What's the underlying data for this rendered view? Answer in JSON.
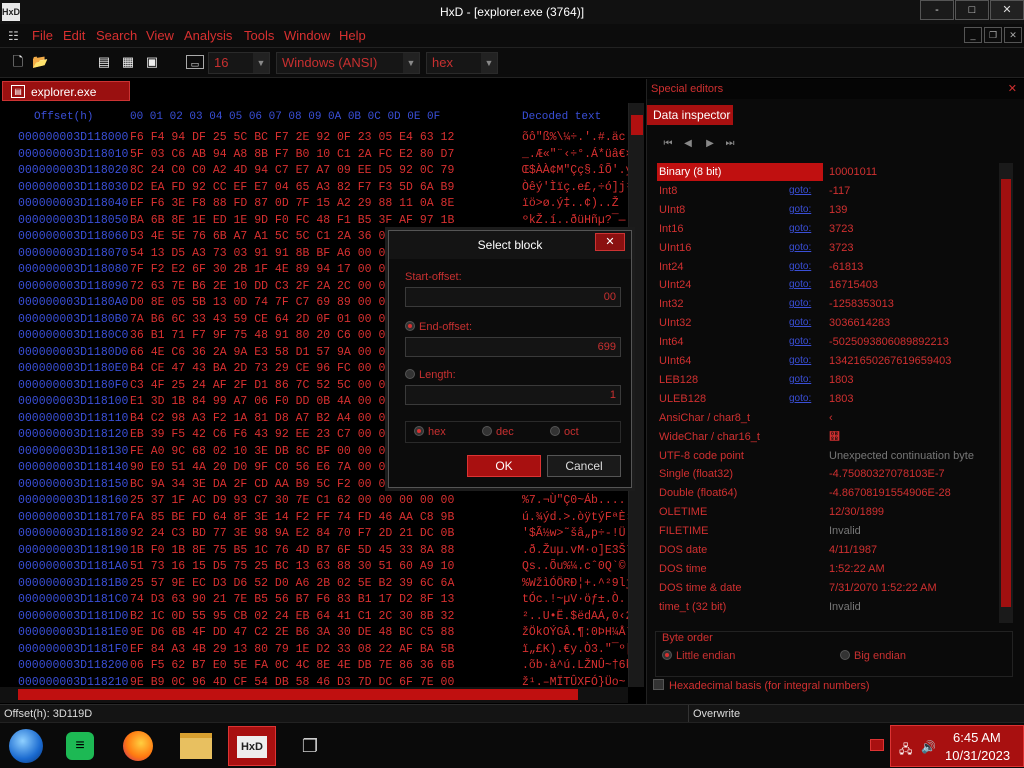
{
  "window": {
    "title": "HxD - [explorer.exe (3764)]",
    "logo": "HxD",
    "minimize": "-",
    "maximize": "□",
    "close": "✕"
  },
  "menu": [
    "File",
    "Edit",
    "Search",
    "View",
    "Analysis",
    "Tools",
    "Window",
    "Help"
  ],
  "toolbar": {
    "bytes_per_row": "16",
    "charset": "Windows (ANSI)",
    "offset_base": "hex"
  },
  "doc_tab": {
    "label": "explorer.exe (3764)"
  },
  "hex_rows": [
    {
      "off": "000000003D118000",
      "hex": "F6 F4 94 DF 25 5C BC F7 2E 92 0F 23 05 E4 63 12",
      "txt": "õô\"ß%\\¼÷.'.#.äc."
    },
    {
      "off": "000000003D118010",
      "hex": "5F 03 C6 AB 94 A8 8B F7 B0 10 C1 2A FC E2 80 D7",
      "txt": "_.Æ«\"¨‹÷°.Á*üâ€×"
    },
    {
      "off": "000000003D118020",
      "hex": "8C 24 C0 C0 A2 4D 94 C7 E7 A7 09 EE D5 92 0C 79",
      "txt": "Œ$ÀÀ¢M\"Çç§.îÕ'.y"
    },
    {
      "off": "000000003D118030",
      "hex": "D2 EA FD 92 CC EF E7 04 65 A3 82 F7 F3 5D 6A B9",
      "txt": "Òêý'Ìïç.e£‚÷ó]j¹"
    },
    {
      "off": "000000003D118040",
      "hex": "EF F6 3E F8 88 FD 87 0D 7F 15 A2 29 88 11 0A 8E",
      "txt": "ïö>ø.ý‡..¢)..Ž"
    },
    {
      "off": "000000003D118050",
      "hex": "BA 6B 8E 1E ED 1E 9D F0 FC 48 F1 B5 3F AF 97 1B",
      "txt": "ºkŽ.í..ðüHñµ?¯—."
    },
    {
      "off": "000000003D118060",
      "hex": "D3 4E 5E 76 6B A7 A1 5C 5C C1 2A 36 00 00 00 00",
      "txt": "ÓN^vk§¡\\\\Á*6...."
    },
    {
      "off": "000000003D118070",
      "hex": "54 13 D5 A3 73 03 91 91 8B BF A6 00 00 00 00 00",
      "txt": "T.Õ£s.''‹¿¦....."
    },
    {
      "off": "000000003D118080",
      "hex": "7F F2 E2 6F 30 2B 1F 4E 89 94 17 00 00 00 00 00",
      "txt": ".òâo0+.N‰\"......"
    },
    {
      "off": "000000003D118090",
      "hex": "72 63 7E B6 2E 10 DD C3 2F 2A 2C 00 00 00 00 00",
      "txt": "rc~¶..ÝÃ/*,....."
    },
    {
      "off": "000000003D1180A0",
      "hex": "D0 8E 05 5B 13 0D 74 7F C7 69 89 00 00 00 00 00",
      "txt": "ÐŽ.[..t.Çi‰....."
    },
    {
      "off": "000000003D1180B0",
      "hex": "7A B6 6C 33 43 59 CE 64 2D 0F 01 00 00 00 00 00",
      "txt": "z¶l3CYÎd-......."
    },
    {
      "off": "000000003D1180C0",
      "hex": "36 B1 71 F7 9F 75 48 91 80 20 C6 00 00 00 00 00",
      "txt": "6±q÷ŸuH'€ Æ....."
    },
    {
      "off": "000000003D1180D0",
      "hex": "66 4E C6 36 2A 9A E3 58 D1 57 9A 00 00 00 00 00",
      "txt": "fNÆ6*šãXÑWš....."
    },
    {
      "off": "000000003D1180E0",
      "hex": "B4 CE 47 43 BA 2D 73 29 CE 96 FC 00 00 00 00 00",
      "txt": "´ÎGCº-s)Î–ü....."
    },
    {
      "off": "000000003D1180F0",
      "hex": "C3 4F 25 24 AF 2F D1 86 7C 52 5C 00 00 00 00 00",
      "txt": "ÃO%$¯/Ñ†|R\\....."
    },
    {
      "off": "000000003D118100",
      "hex": "E1 3D 1B 84 99 A7 06 F0 DD 0B 4A 00 00 00 00 00",
      "txt": "á=.„™§.ðÝ.J....."
    },
    {
      "off": "000000003D118110",
      "hex": "B4 C2 98 A3 F2 1A 81 D8 A7 B2 A4 00 00 00 00 00",
      "txt": "´Â˜£ò..Ø§²¤....."
    },
    {
      "off": "000000003D118120",
      "hex": "EB 39 F5 42 C6 F6 43 92 EE 23 C7 00 00 00 00 00",
      "txt": "ë9õBÆöC'î#Ç....."
    },
    {
      "off": "000000003D118130",
      "hex": "FE A0 9C 68 02 10 3E DB 8C BF 00 00 00 00 00 00",
      "txt": "þ œh..>ÛŒ¿......"
    },
    {
      "off": "000000003D118140",
      "hex": "90 E0 51 4A 20 D0 9F C0 56 E6 7A 00 00 00 00 00",
      "txt": ".àQJ ÐŸÀVæz....."
    },
    {
      "off": "000000003D118150",
      "hex": "BC 9A 34 3E DA 2F CD AA B9 5C F2 00 00 00 00 00",
      "txt": "¼š4>Ú/Íª¹\\ò....."
    },
    {
      "off": "000000003D118160",
      "hex": "25 37 1F AC D9 93 C7 30 7E C1 62 00 00 00 00 00",
      "txt": "%7.¬Ù\"Ç0~Áb....."
    },
    {
      "off": "000000003D118170",
      "hex": "FA 85 BE FD 64 8F 3E 14 F2 FF 74 FD 46 AA C8 9B",
      "txt": "ú.¾ýd.>.òÿtýFªÈ›"
    },
    {
      "off": "000000003D118180",
      "hex": "92 24 C3 BD 77 3E 98 9A E2 84 70 F7 2D 21 DC 0B",
      "txt": "'$Ã½w>˜šâ„p÷-!Ü."
    },
    {
      "off": "000000003D118190",
      "hex": "1B F0 1B 8E 75 B5 1C 76 4D B7 6F 5D 45 33 8A 88",
      "txt": ".ð.Žuµ.vM·o]E3Šˆ"
    },
    {
      "off": "000000003D1181A0",
      "hex": "51 73 16 15 D5 75 25 BC 13 63 88 30 51 60 A9 10",
      "txt": "Qs..Õu%¼.cˆ0Q`©."
    },
    {
      "off": "000000003D1181B0",
      "hex": "25 57 9E EC D3 D6 52 D0 A6 2B 02 5E B2 39 6C 6A",
      "txt": "%WžìÓÖRÐ¦+.^²9lj"
    },
    {
      "off": "000000003D1181C0",
      "hex": "74 D3 63 90 21 7E B5 56 B7 F6 83 B1 17 D2 8F 13",
      "txt": "tÓc.!~µV·öƒ±.Ò.."
    },
    {
      "off": "000000003D1181D0",
      "hex": "B2 1C 0D 55 95 CB 02 24 EB 64 41 C1 2C 30 8B 32",
      "txt": "²..U•Ë.$ëdAÁ,0‹2"
    },
    {
      "off": "000000003D1181E0",
      "hex": "9E D6 6B 4F DD 47 C2 2E B6 3A 30 DE 48 BC C5 88",
      "txt": "žÖkOÝGÂ.¶:0ÞH¼Åˆ"
    },
    {
      "off": "000000003D1181F0",
      "hex": "EF 84 A3 4B 29 13 80 79 1E D2 33 08 22 AF BA 5B",
      "txt": "ï„£K).€y.Ò3.\"¯º["
    },
    {
      "off": "000000003D118200",
      "hex": "06 F5 62 B7 E0 5E FA 0C 4C 8E 4E DB 7E 86 36 6B",
      "txt": ".õb·à^ú.LŽNÛ~†6k"
    },
    {
      "off": "000000003D118210",
      "hex": "9E B9 0C 96 4D CF 54 DB 58 46 D3 7D DC 6F 7E 00",
      "txt": "ž¹.–MÏTÛXFÓ}Üo~."
    }
  ],
  "hex_header": {
    "offset": "Offset(h)",
    "cols": "00 01 02 03 04 05 06 07 08 09 0A 0B 0C 0D 0E 0F",
    "text": "Decoded text"
  },
  "status": {
    "offset": "Offset(h): 3D119D",
    "mode": "Overwrite"
  },
  "special": {
    "header": "Special editors",
    "tab": "Data inspector",
    "rows": [
      {
        "label": "Binary (8 bit)",
        "link": "",
        "value": "10001011",
        "cls": "sel"
      },
      {
        "label": "Int8",
        "link": "goto:",
        "value": "-117",
        "cls": ""
      },
      {
        "label": "UInt8",
        "link": "goto:",
        "value": "139",
        "cls": ""
      },
      {
        "label": "Int16",
        "link": "goto:",
        "value": "3723",
        "cls": ""
      },
      {
        "label": "UInt16",
        "link": "goto:",
        "value": "3723",
        "cls": ""
      },
      {
        "label": "Int24",
        "link": "goto:",
        "value": "-61813",
        "cls": ""
      },
      {
        "label": "UInt24",
        "link": "goto:",
        "value": "16715403",
        "cls": ""
      },
      {
        "label": "Int32",
        "link": "goto:",
        "value": "-1258353013",
        "cls": ""
      },
      {
        "label": "UInt32",
        "link": "goto:",
        "value": "3036614283",
        "cls": ""
      },
      {
        "label": "Int64",
        "link": "goto:",
        "value": "-5025093806089892213",
        "cls": ""
      },
      {
        "label": "UInt64",
        "link": "goto:",
        "value": "13421650267619659403",
        "cls": ""
      },
      {
        "label": "LEB128",
        "link": "goto:",
        "value": "1803",
        "cls": ""
      },
      {
        "label": "ULEB128",
        "link": "goto:",
        "value": "1803",
        "cls": ""
      },
      {
        "label": "AnsiChar / char8_t",
        "link": "",
        "value": "‹",
        "cls": ""
      },
      {
        "label": "WideChar / char16_t",
        "link": "",
        "value": "஋",
        "cls": ""
      },
      {
        "label": "UTF-8 code point",
        "link": "",
        "value": "Unexpected continuation byte",
        "cls": "grayv"
      },
      {
        "label": "Single (float32)",
        "link": "",
        "value": "-4.75080327078103E-7",
        "cls": ""
      },
      {
        "label": "Double (float64)",
        "link": "",
        "value": "-4.86708191554906E-28",
        "cls": ""
      },
      {
        "label": "OLETIME",
        "link": "",
        "value": "12/30/1899",
        "cls": ""
      },
      {
        "label": "FILETIME",
        "link": "",
        "value": "Invalid",
        "cls": "grayv"
      },
      {
        "label": "DOS date",
        "link": "",
        "value": "4/11/1987",
        "cls": ""
      },
      {
        "label": "DOS time",
        "link": "",
        "value": "1:52:22 AM",
        "cls": ""
      },
      {
        "label": "DOS time & date",
        "link": "",
        "value": "7/31/2070 1:52:22 AM",
        "cls": ""
      },
      {
        "label": "time_t (32 bit)",
        "link": "",
        "value": "Invalid",
        "cls": "grayv"
      }
    ],
    "byte_order_label": "Byte order",
    "little_endian": "Little endian",
    "big_endian": "Big endian",
    "hex_basis": "Hexadecimal basis (for integral numbers)"
  },
  "dialog": {
    "title": "Select block",
    "start_label": "Start-offset:",
    "start_value": "00",
    "end_label": "End-offset:",
    "end_value": "699",
    "length_label": "Length:",
    "length_value": "1",
    "hex": "hex",
    "dec": "dec",
    "oct": "oct",
    "ok": "OK",
    "cancel": "Cancel"
  },
  "taskbar": {
    "time": "6:45 AM",
    "date": "10/31/2023"
  },
  "colors": {
    "accent": "#c01010",
    "text_red": "#d83030",
    "offset_blue": "#3a4fd8"
  }
}
